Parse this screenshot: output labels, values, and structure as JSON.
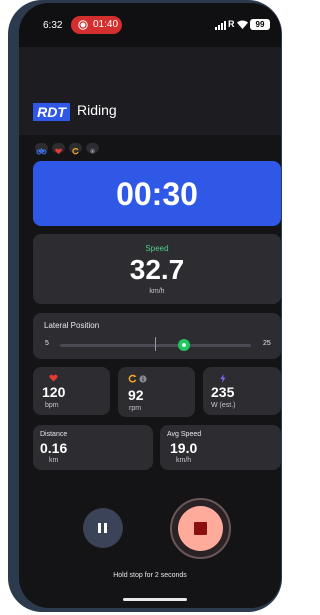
{
  "status_bar": {
    "time": "6:32",
    "recording_time": "01:40",
    "carrier_glyph": "R",
    "battery": "99"
  },
  "header": {
    "logo_text": "RDT",
    "title": "Riding"
  },
  "status_chips": [
    "bike-icon",
    "heart-icon",
    "cadence-icon",
    "info-icon"
  ],
  "timer": {
    "value": "00:30"
  },
  "speed": {
    "label": "Speed",
    "value": "32.7",
    "unit": "km/h"
  },
  "lateral_position": {
    "label": "Lateral Position",
    "min_label": "5",
    "max_label": "25",
    "min": 5,
    "max": 25,
    "value": 18
  },
  "metrics": {
    "heart_rate": {
      "value": "120",
      "unit": "bpm"
    },
    "cadence": {
      "value": "92",
      "unit": "rpm"
    },
    "power": {
      "value": "235",
      "unit": "W (est.)"
    }
  },
  "distance": {
    "label": "Distance",
    "value": "0.16",
    "unit": "km"
  },
  "avg_speed": {
    "label": "Avg Speed",
    "value": "19.0",
    "unit": "km/h"
  },
  "controls": {
    "hint": "Hold stop for 2 seconds"
  },
  "colors": {
    "accent_blue": "#2f58e6",
    "speed_green": "#4fd18b",
    "slider_green": "#22c55e",
    "heart_red": "#e53935",
    "cadence_orange": "#f5a623",
    "power_purple": "#7c6cf0",
    "stop_pink": "#ffab9c",
    "recording_red": "#d32f2f"
  }
}
